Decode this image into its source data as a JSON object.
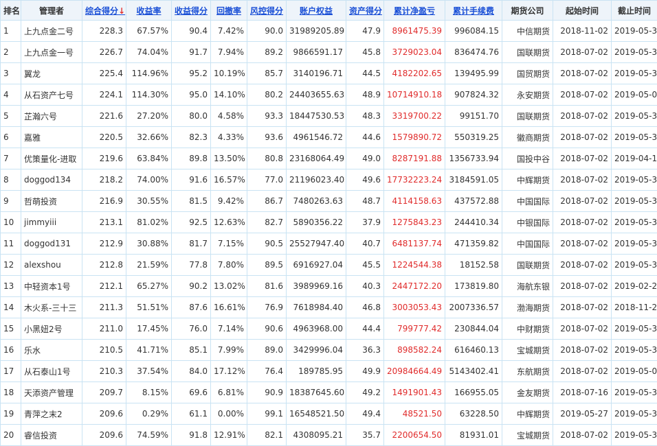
{
  "colors": {
    "link": "#1a4fd6",
    "profit": "#e02b2b",
    "header_bg": "#eef4fa",
    "border": "#c9e3f3"
  },
  "headers": [
    "排名",
    "管理者",
    "综合得分",
    "收益率",
    "收益得分",
    "回撤率",
    "风控得分",
    "账户权益",
    "资产得分",
    "累计净盈亏",
    "累计手续费",
    "期货公司",
    "起始时间",
    "截止时间"
  ],
  "sort_arrow": "↓",
  "rows": [
    [
      "1",
      "上九点金二号",
      "228.3",
      "67.57%",
      "90.4",
      "7.42%",
      "90.0",
      "31989205.89",
      "47.9",
      "8961475.39",
      "996084.15",
      "中信期货",
      "2018-11-02",
      "2019-05-30"
    ],
    [
      "2",
      "上九点金一号",
      "226.7",
      "74.04%",
      "91.7",
      "7.94%",
      "89.2",
      "9866591.17",
      "45.8",
      "3729023.04",
      "836474.76",
      "国联期货",
      "2018-07-02",
      "2019-05-31"
    ],
    [
      "3",
      "翼龙",
      "225.4",
      "114.96%",
      "95.2",
      "10.19%",
      "85.7",
      "3140196.71",
      "44.5",
      "4182202.65",
      "139495.99",
      "国贸期货",
      "2018-07-02",
      "2019-05-31"
    ],
    [
      "4",
      "从石资产七号",
      "224.1",
      "114.30%",
      "95.0",
      "14.10%",
      "80.2",
      "24403655.63",
      "48.9",
      "10714910.18",
      "907824.32",
      "永安期货",
      "2018-07-02",
      "2019-05-08"
    ],
    [
      "5",
      "芷瀚六号",
      "221.6",
      "27.20%",
      "80.0",
      "4.58%",
      "93.3",
      "18447530.53",
      "48.3",
      "3319700.22",
      "99151.70",
      "国联期货",
      "2018-07-02",
      "2019-05-31"
    ],
    [
      "6",
      "嘉雅",
      "220.5",
      "32.66%",
      "82.3",
      "4.33%",
      "93.6",
      "4961546.72",
      "44.6",
      "1579890.72",
      "550319.25",
      "徽商期货",
      "2018-07-02",
      "2019-05-31"
    ],
    [
      "7",
      "优策量化-进取",
      "219.6",
      "63.84%",
      "89.8",
      "13.50%",
      "80.8",
      "23168064.49",
      "49.0",
      "8287191.88",
      "1356733.94",
      "国投中谷",
      "2018-07-02",
      "2019-04-15"
    ],
    [
      "8",
      "doggod134",
      "218.2",
      "74.00%",
      "91.6",
      "16.57%",
      "77.0",
      "21196023.40",
      "49.6",
      "17732223.24",
      "3184591.05",
      "中辉期货",
      "2018-07-02",
      "2019-05-31"
    ],
    [
      "9",
      "哲萌投资",
      "216.9",
      "30.55%",
      "81.5",
      "9.42%",
      "86.7",
      "7480263.63",
      "48.7",
      "4114158.63",
      "437572.88",
      "中国国际",
      "2018-07-02",
      "2019-05-31"
    ],
    [
      "10",
      "jimmyiii",
      "213.1",
      "81.02%",
      "92.5",
      "12.63%",
      "82.7",
      "5890356.22",
      "37.9",
      "1275843.23",
      "244410.34",
      "中银国际",
      "2018-07-02",
      "2019-05-31"
    ],
    [
      "11",
      "doggod131",
      "212.9",
      "30.88%",
      "81.7",
      "7.15%",
      "90.5",
      "25527947.40",
      "40.7",
      "6481137.74",
      "471359.82",
      "中国国际",
      "2018-07-02",
      "2019-05-31"
    ],
    [
      "12",
      "alexshou",
      "212.8",
      "21.59%",
      "77.8",
      "7.80%",
      "89.5",
      "6916927.04",
      "45.5",
      "1224544.38",
      "18152.58",
      "国联期货",
      "2018-07-02",
      "2019-05-31"
    ],
    [
      "13",
      "中轻资本1号",
      "212.1",
      "65.27%",
      "90.2",
      "13.02%",
      "81.6",
      "3989969.16",
      "40.3",
      "2447172.20",
      "173819.80",
      "海航东银",
      "2018-07-02",
      "2019-02-22"
    ],
    [
      "14",
      "木火系-三十三",
      "211.3",
      "51.51%",
      "87.6",
      "16.61%",
      "76.9",
      "7618984.40",
      "46.8",
      "3003053.43",
      "2007336.57",
      "渤海期货",
      "2018-07-02",
      "2018-11-26"
    ],
    [
      "15",
      "小黑妞2号",
      "211.0",
      "17.45%",
      "76.0",
      "7.14%",
      "90.6",
      "4963968.00",
      "44.4",
      "799777.42",
      "230844.04",
      "中财期货",
      "2018-07-02",
      "2019-05-31"
    ],
    [
      "16",
      "乐水",
      "210.5",
      "41.71%",
      "85.1",
      "7.99%",
      "89.0",
      "3429996.04",
      "36.3",
      "898582.24",
      "616460.13",
      "宝城期货",
      "2018-07-02",
      "2019-05-31"
    ],
    [
      "17",
      "从石泰山1号",
      "210.3",
      "37.54%",
      "84.0",
      "17.12%",
      "76.4",
      "189785.95",
      "49.9",
      "20984664.49",
      "5143402.41",
      "东航期货",
      "2018-07-02",
      "2019-05-08"
    ],
    [
      "18",
      "天添资产管理",
      "209.7",
      "8.15%",
      "69.6",
      "6.81%",
      "90.9",
      "18387645.60",
      "49.2",
      "1491901.43",
      "166955.05",
      "金友期货",
      "2018-07-16",
      "2019-05-31"
    ],
    [
      "19",
      "青萍之末2",
      "209.6",
      "0.29%",
      "61.1",
      "0.00%",
      "99.1",
      "16548521.50",
      "49.4",
      "48521.50",
      "63228.50",
      "中辉期货",
      "2019-05-27",
      "2019-05-31"
    ],
    [
      "20",
      "睿信投资",
      "209.6",
      "74.59%",
      "91.8",
      "12.91%",
      "82.1",
      "4308095.21",
      "35.7",
      "2200654.50",
      "81931.01",
      "宝城期货",
      "2018-07-02",
      "2019-05-31"
    ]
  ]
}
